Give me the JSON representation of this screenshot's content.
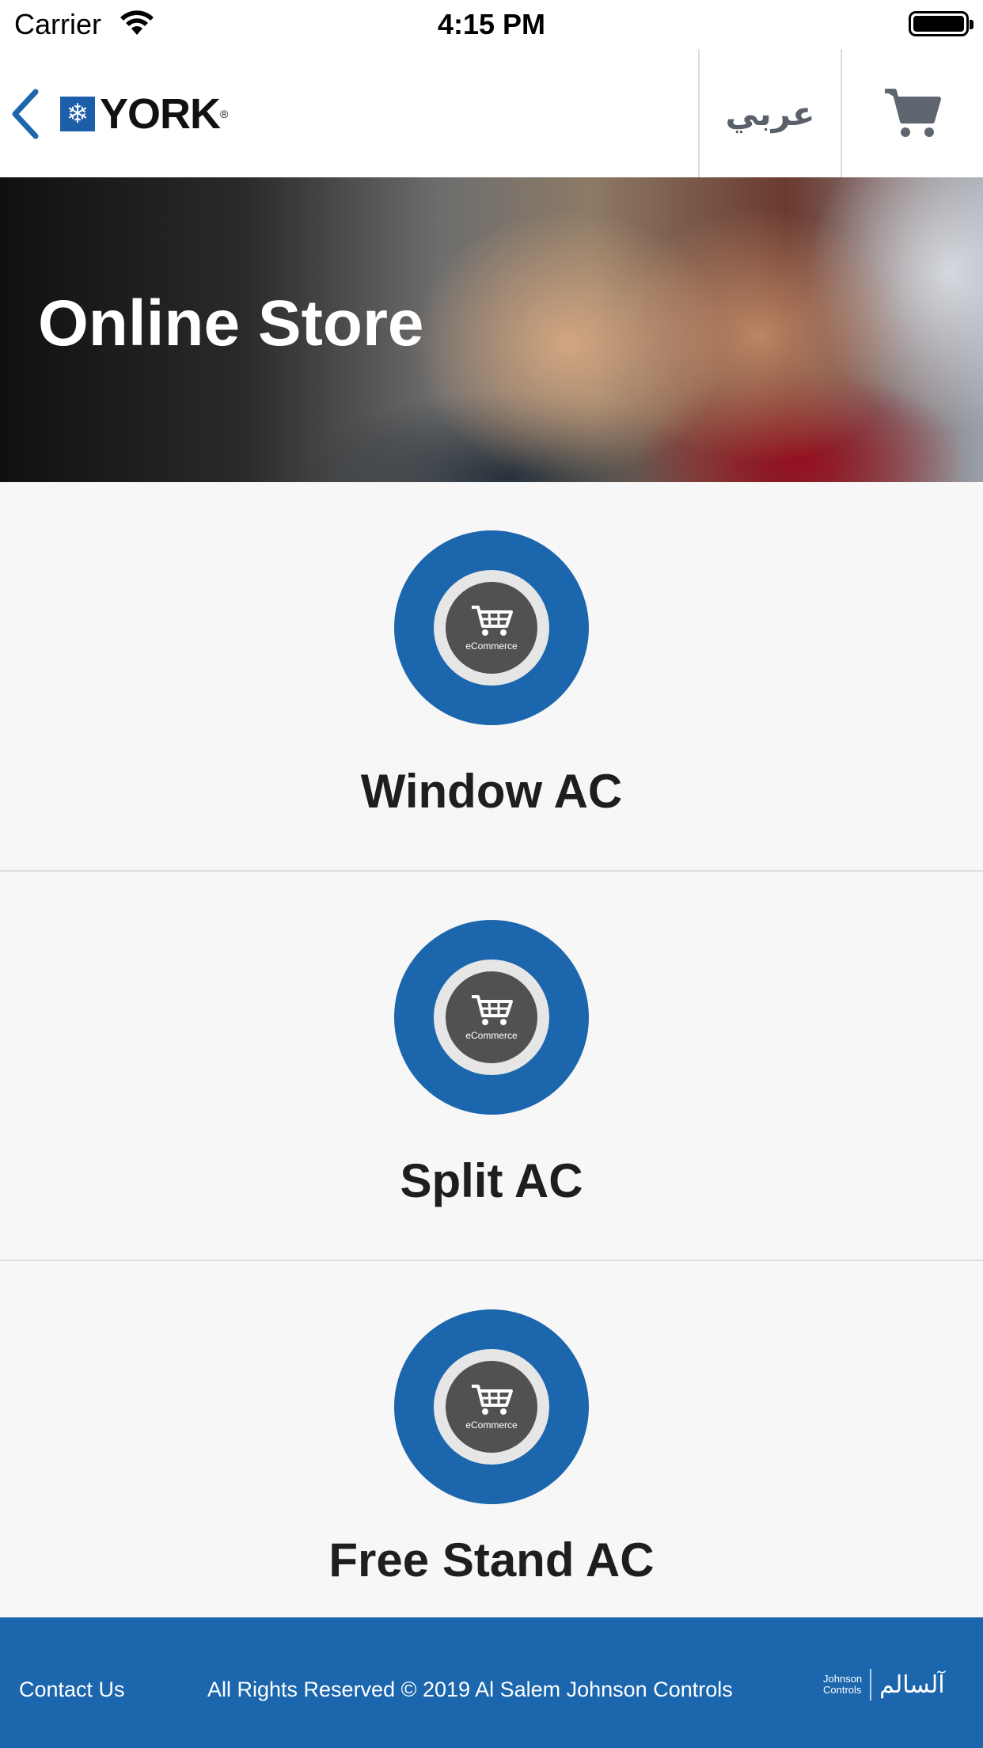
{
  "status_bar": {
    "carrier": "Carrier",
    "time": "4:15 PM"
  },
  "header": {
    "brand": "YORK",
    "brand_reg": "®",
    "language_button": "عربي",
    "icons": [
      "back-chevron-icon",
      "york-snowflake-icon",
      "cart-icon"
    ]
  },
  "hero": {
    "title": "Online Store"
  },
  "categories": [
    {
      "title": "Window AC",
      "badge_label": "eCommerce"
    },
    {
      "title": "Split AC",
      "badge_label": "eCommerce"
    },
    {
      "title": "Free Stand AC",
      "badge_label": "eCommerce"
    }
  ],
  "footer": {
    "contact": "Contact Us",
    "copyright": "All Rights Reserved © 2019 Al Salem Johnson Controls",
    "logo_johnson_line1": "Johnson",
    "logo_johnson_line2": "Controls",
    "logo_alsalem": "آلسالم"
  },
  "colors": {
    "brand_blue": "#1b66ad",
    "badge_core": "#515151",
    "background": "#f7f7f7",
    "lang_text": "#5a6069"
  }
}
